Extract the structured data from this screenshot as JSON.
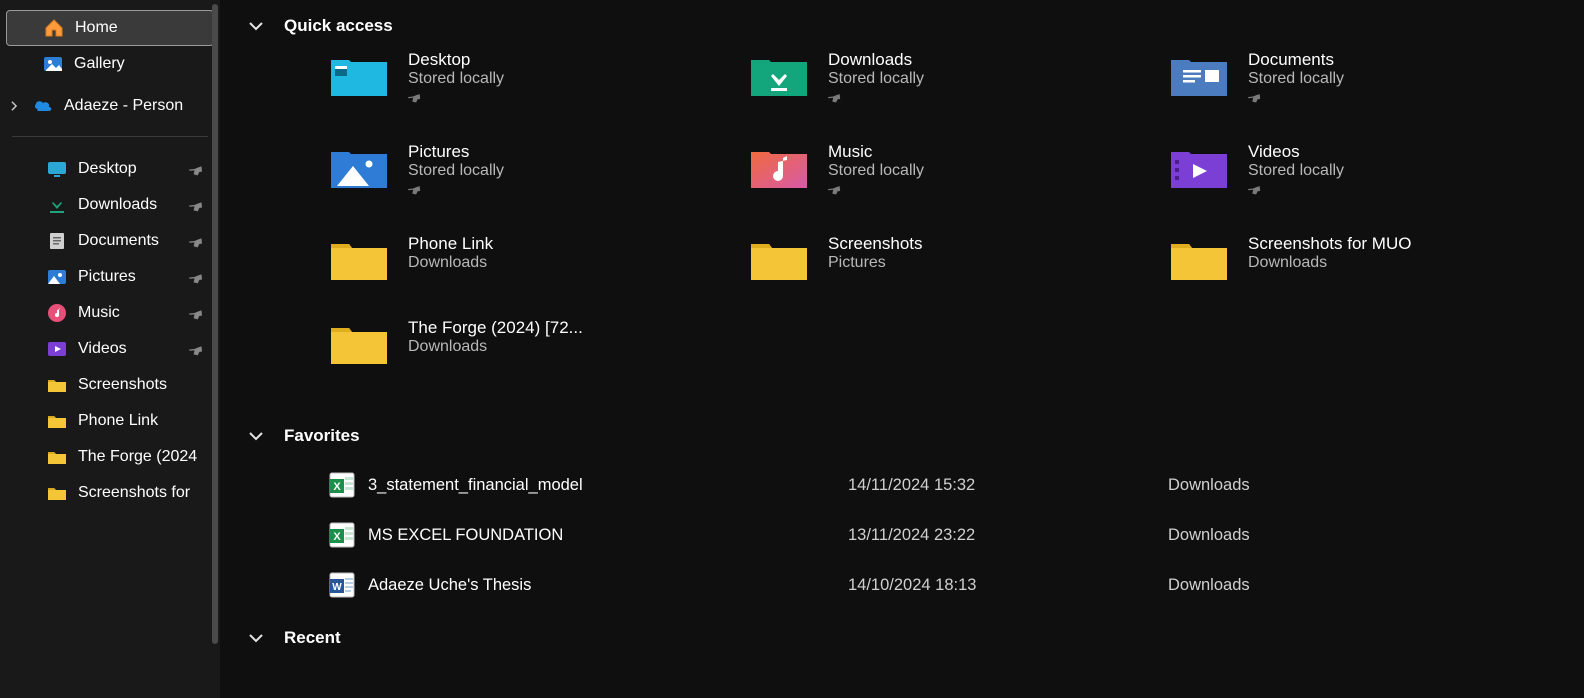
{
  "sidebar": {
    "home": "Home",
    "gallery": "Gallery",
    "onedrive": "Adaeze - Person",
    "quick": [
      {
        "label": "Desktop",
        "pinned": true,
        "icon": "desktop"
      },
      {
        "label": "Downloads",
        "pinned": true,
        "icon": "downloads"
      },
      {
        "label": "Documents",
        "pinned": true,
        "icon": "documents"
      },
      {
        "label": "Pictures",
        "pinned": true,
        "icon": "pictures"
      },
      {
        "label": "Music",
        "pinned": true,
        "icon": "music"
      },
      {
        "label": "Videos",
        "pinned": true,
        "icon": "videos"
      },
      {
        "label": "Screenshots",
        "pinned": false,
        "icon": "folder"
      },
      {
        "label": "Phone Link",
        "pinned": false,
        "icon": "folder"
      },
      {
        "label": "The Forge (2024",
        "pinned": false,
        "icon": "folder"
      },
      {
        "label": "Screenshots for",
        "pinned": false,
        "icon": "folder"
      }
    ]
  },
  "sections": {
    "quick_access": "Quick access",
    "favorites": "Favorites",
    "recent": "Recent"
  },
  "quick_access": [
    {
      "title": "Desktop",
      "sub": "Stored locally",
      "pinned": true,
      "icon": "desktop-lg"
    },
    {
      "title": "Downloads",
      "sub": "Stored locally",
      "pinned": true,
      "icon": "downloads-lg"
    },
    {
      "title": "Documents",
      "sub": "Stored locally",
      "pinned": true,
      "icon": "documents-lg"
    },
    {
      "title": "Pictures",
      "sub": "Stored locally",
      "pinned": true,
      "icon": "pictures-lg"
    },
    {
      "title": "Music",
      "sub": "Stored locally",
      "pinned": true,
      "icon": "music-lg"
    },
    {
      "title": "Videos",
      "sub": "Stored locally",
      "pinned": true,
      "icon": "videos-lg"
    },
    {
      "title": "Phone Link",
      "sub": "Downloads",
      "pinned": false,
      "icon": "folder-lg"
    },
    {
      "title": "Screenshots",
      "sub": "Pictures",
      "pinned": false,
      "icon": "folder-lg"
    },
    {
      "title": "Screenshots for MUO",
      "sub": "Downloads",
      "pinned": false,
      "icon": "folder-lg"
    },
    {
      "title": "The Forge (2024) [72...",
      "sub": "Downloads",
      "pinned": false,
      "icon": "folder-lg"
    }
  ],
  "favorites": [
    {
      "name": "3_statement_financial_model",
      "date": "14/11/2024 15:32",
      "location": "Downloads",
      "icon": "excel"
    },
    {
      "name": "MS EXCEL FOUNDATION",
      "date": "13/11/2024 23:22",
      "location": "Downloads",
      "icon": "excel"
    },
    {
      "name": "Adaeze Uche's Thesis",
      "date": "14/10/2024 18:13",
      "location": "Downloads",
      "icon": "word"
    }
  ]
}
